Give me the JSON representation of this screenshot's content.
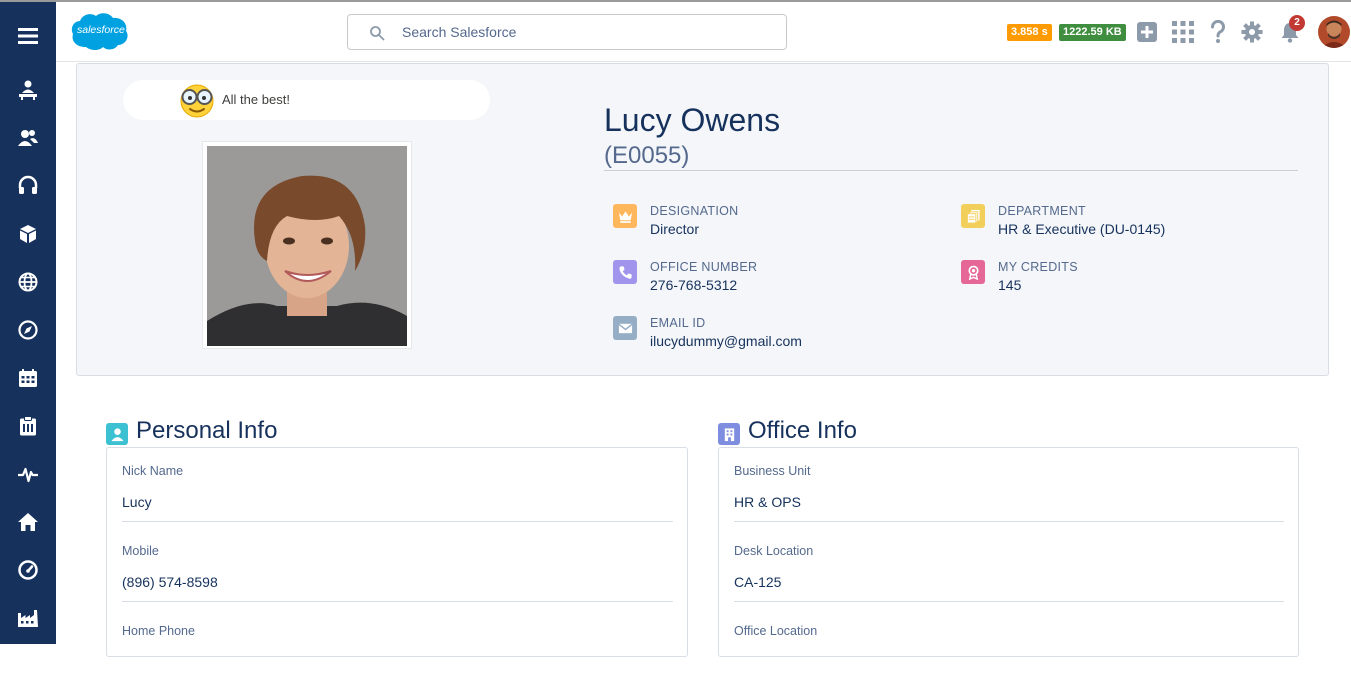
{
  "header": {
    "search_placeholder": "Search Salesforce",
    "logo_text": "salesforce",
    "timing_badge": "3.858 s",
    "size_badge": "1222.59 KB",
    "notification_count": "2"
  },
  "profile": {
    "quote": "All the best!",
    "name": "Lucy Owens",
    "employee_id": "(E0055)",
    "fields": {
      "designation": {
        "label": "DESIGNATION",
        "value": "Director"
      },
      "department": {
        "label": "DEPARTMENT",
        "value": "HR & Executive (DU-0145)"
      },
      "office_number": {
        "label": "OFFICE NUMBER",
        "value": "276-768-5312"
      },
      "my_credits": {
        "label": "MY CREDITS",
        "value": "145"
      },
      "email_id": {
        "label": "EMAIL ID",
        "value": "ilucydummy@gmail.com"
      }
    }
  },
  "personal_info": {
    "title": "Personal Info",
    "rows": [
      {
        "label": "Nick Name",
        "value": "Lucy"
      },
      {
        "label": "Mobile",
        "value": "(896) 574-8598"
      },
      {
        "label": "Home Phone",
        "value": ""
      }
    ]
  },
  "office_info": {
    "title": "Office Info",
    "rows": [
      {
        "label": "Business Unit",
        "value": "HR & OPS"
      },
      {
        "label": "Desk Location",
        "value": "CA-125"
      },
      {
        "label": "Office Location",
        "value": ""
      }
    ]
  },
  "colors": {
    "sidebar": "#16325c",
    "designation_icon": "#ffb75d",
    "department_icon": "#f2cf5b",
    "office_number_icon": "#a094ed",
    "credits_icon": "#e56798",
    "email_icon": "#95aec5",
    "personal_icon": "#3bc1d1",
    "office_icon": "#7f8de1",
    "timing_badge": "#ff9a00",
    "size_badge": "#3f8d3f"
  }
}
